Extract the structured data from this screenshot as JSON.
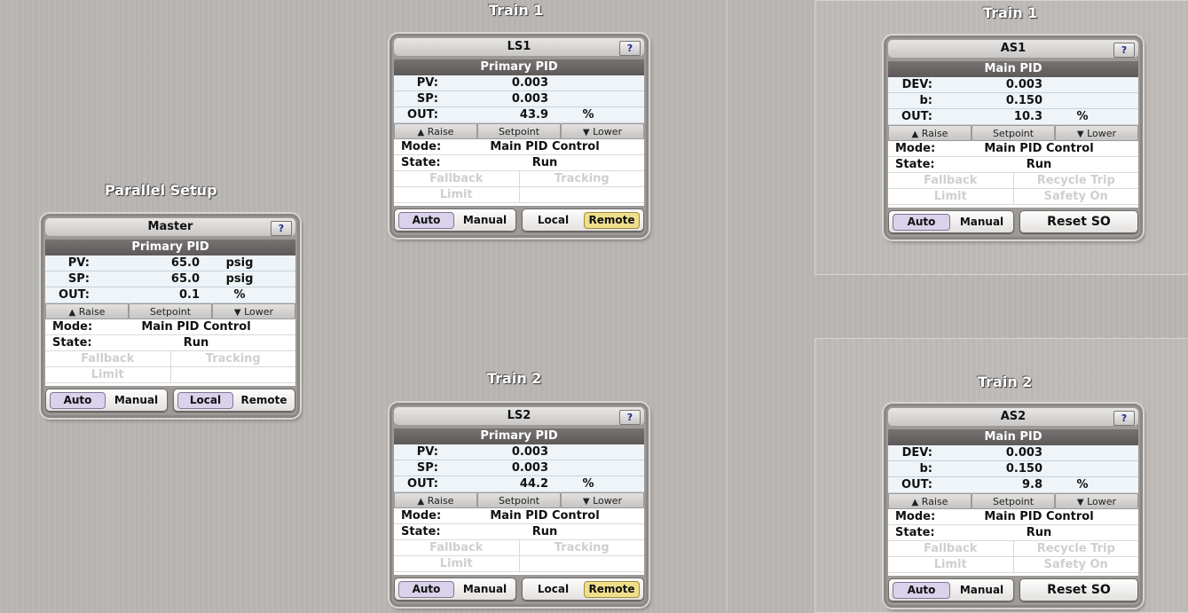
{
  "titles": {
    "parallel": "Parallel Setup",
    "ls_train1": "Train 1",
    "ls_train2": "Train 2",
    "as_train1": "Train 1",
    "as_train2": "Train 2"
  },
  "panels": {
    "master": {
      "name": "Master",
      "help": "?",
      "section": "Primary PID",
      "r1": {
        "label": "PV:",
        "value": "65.0",
        "unit": "psig"
      },
      "r2": {
        "label": "SP:",
        "value": "65.0",
        "unit": "psig"
      },
      "r3": {
        "label": "OUT:",
        "value": "0.1",
        "unit": "%"
      },
      "raise": "Raise",
      "setpoint": "Setpoint",
      "lower": "Lower",
      "mode_label": "Mode:",
      "mode": "Main PID Control",
      "state_label": "State:",
      "state": "Run",
      "g1": "Fallback",
      "g2": "Tracking",
      "g3": "Limit",
      "g4": "",
      "b1": "Auto",
      "b2": "Manual",
      "b3": "Local",
      "b4": "Remote"
    },
    "ls1": {
      "name": "LS1",
      "help": "?",
      "section": "Primary PID",
      "r1": {
        "label": "PV:",
        "value": "0.003",
        "unit": ""
      },
      "r2": {
        "label": "SP:",
        "value": "0.003",
        "unit": ""
      },
      "r3": {
        "label": "OUT:",
        "value": "43.9",
        "unit": "%"
      },
      "raise": "Raise",
      "setpoint": "Setpoint",
      "lower": "Lower",
      "mode_label": "Mode:",
      "mode": "Main PID Control",
      "state_label": "State:",
      "state": "Run",
      "g1": "Fallback",
      "g2": "Tracking",
      "g3": "Limit",
      "g4": "",
      "b1": "Auto",
      "b2": "Manual",
      "b3": "Local",
      "b4": "Remote"
    },
    "ls2": {
      "name": "LS2",
      "help": "?",
      "section": "Primary PID",
      "r1": {
        "label": "PV:",
        "value": "0.003",
        "unit": ""
      },
      "r2": {
        "label": "SP:",
        "value": "0.003",
        "unit": ""
      },
      "r3": {
        "label": "OUT:",
        "value": "44.2",
        "unit": "%"
      },
      "raise": "Raise",
      "setpoint": "Setpoint",
      "lower": "Lower",
      "mode_label": "Mode:",
      "mode": "Main PID Control",
      "state_label": "State:",
      "state": "Run",
      "g1": "Fallback",
      "g2": "Tracking",
      "g3": "Limit",
      "g4": "",
      "b1": "Auto",
      "b2": "Manual",
      "b3": "Local",
      "b4": "Remote"
    },
    "as1": {
      "name": "AS1",
      "help": "?",
      "section": "Main PID",
      "r1": {
        "label": "DEV:",
        "value": "0.003",
        "unit": ""
      },
      "r2": {
        "label": "b:",
        "value": "0.150",
        "unit": ""
      },
      "r3": {
        "label": "OUT:",
        "value": "10.3",
        "unit": "%"
      },
      "raise": "Raise",
      "setpoint": "Setpoint",
      "lower": "Lower",
      "mode_label": "Mode:",
      "mode": "Main PID Control",
      "state_label": "State:",
      "state": "Run",
      "g1": "Fallback",
      "g2": "Recycle Trip",
      "g3": "Limit",
      "g4": "Safety On",
      "b1": "Auto",
      "b2": "Manual",
      "reset": "Reset SO"
    },
    "as2": {
      "name": "AS2",
      "help": "?",
      "section": "Main PID",
      "r1": {
        "label": "DEV:",
        "value": "0.003",
        "unit": ""
      },
      "r2": {
        "label": "b:",
        "value": "0.150",
        "unit": ""
      },
      "r3": {
        "label": "OUT:",
        "value": "9.8",
        "unit": "%"
      },
      "raise": "Raise",
      "setpoint": "Setpoint",
      "lower": "Lower",
      "mode_label": "Mode:",
      "mode": "Main PID Control",
      "state_label": "State:",
      "state": "Run",
      "g1": "Fallback",
      "g2": "Recycle Trip",
      "g3": "Limit",
      "g4": "Safety On",
      "b1": "Auto",
      "b2": "Manual",
      "reset": "Reset SO"
    }
  },
  "colors": {
    "selected_mode": "#d9d2ea",
    "selected_remote": "#efdf8c",
    "section_bar": "#6a6766",
    "disabled_text": "#cfcfcf"
  }
}
